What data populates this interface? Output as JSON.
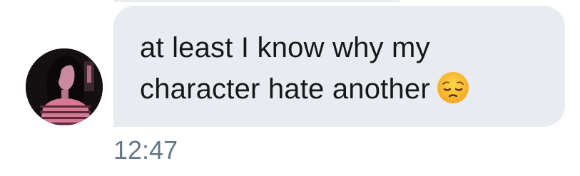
{
  "message": {
    "line1": "at least I know why my",
    "line2": "character hate another",
    "emoji": "pensive-face",
    "timestamp": "12:47"
  },
  "sender": {
    "avatar": "avatar-photo"
  },
  "colors": {
    "bubble": "#e8ecf0",
    "text": "#16171a",
    "timestamp": "#657786",
    "background": "#ffffff"
  }
}
